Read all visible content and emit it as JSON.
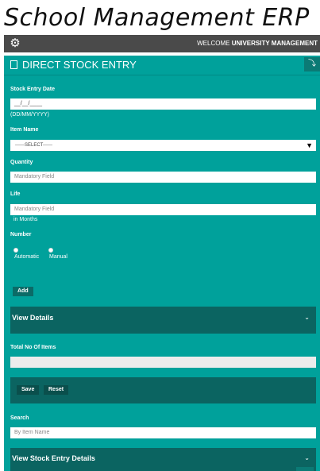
{
  "app": {
    "title": "School Management ERP"
  },
  "topbar": {
    "welcome_prefix": "WELCOME",
    "user": "UNIVERSITY MANAGEMENT"
  },
  "panel": {
    "title": "DIRECT STOCK ENTRY"
  },
  "form": {
    "stock_entry_date": {
      "label": "Stock Entry Date",
      "value": "__/__/____",
      "format_hint": "(DD/MM/YYYY)"
    },
    "item_name": {
      "label": "Item Name",
      "selected": "------SELECT------"
    },
    "quantity": {
      "label": "Quantity",
      "placeholder": "Mandatory Field"
    },
    "life": {
      "label": "Life",
      "placeholder": "Mandatory Field",
      "unit_hint": "in Months"
    },
    "number": {
      "label": "Number",
      "options": [
        "Automatic",
        "Manual"
      ]
    },
    "add_label": "Add"
  },
  "view_details": {
    "label": "View Details"
  },
  "totals": {
    "label": "Total No Of Items"
  },
  "actions": {
    "save_label": "Save",
    "reset_label": "Reset"
  },
  "search": {
    "label": "Search",
    "placeholder": "By Item Name"
  },
  "stock_entry_details": {
    "label": "View Stock Entry Details"
  }
}
